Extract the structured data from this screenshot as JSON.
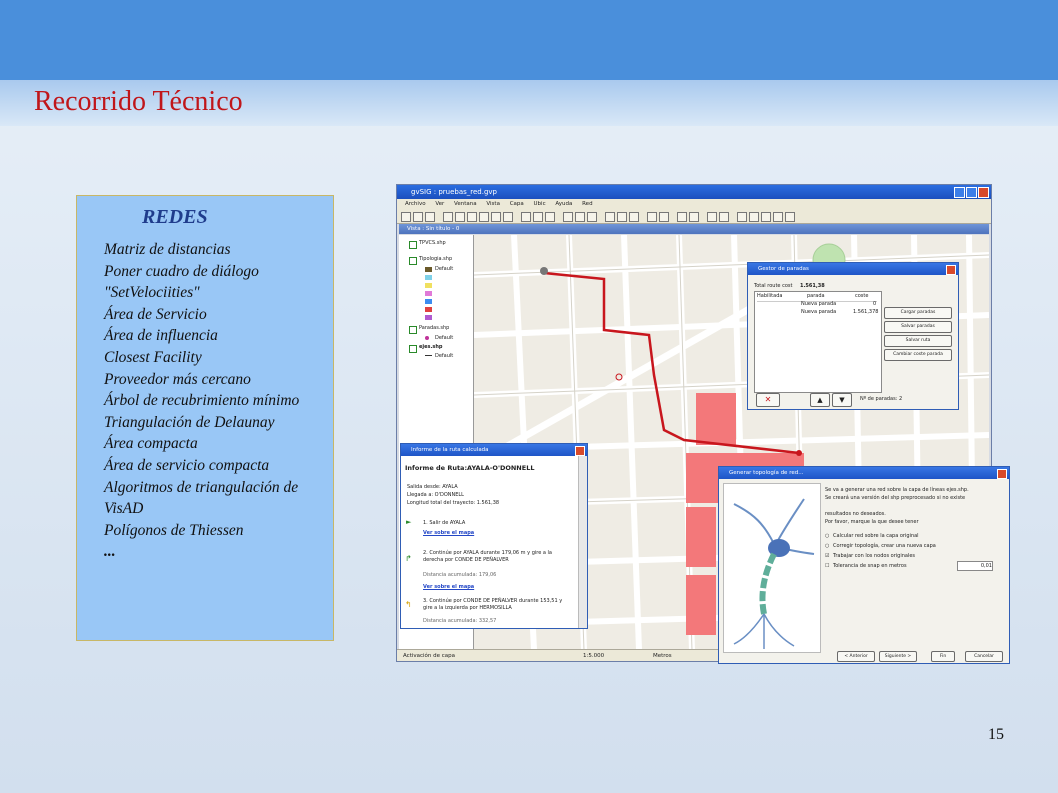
{
  "slide": {
    "title": "Recorrido Técnico",
    "page_number": "15"
  },
  "list": {
    "heading": "REDES",
    "items": [
      "Matriz de distancias",
      "Poner cuadro de diálogo",
      "\"SetVelociities\"",
      "Área de Servicio",
      "Área de influencia",
      "Closest Facility",
      "Proveedor más cercano",
      "Árbol de recubrimiento mínimo",
      "Triangulación de Delaunay",
      "Área compacta",
      "Área de servicio compacta",
      "Algoritmos de triangulación de",
      "VisAD",
      "Polígonos de Thiessen",
      "..."
    ]
  },
  "screenshot": {
    "app_title": "gvSIG : pruebas_red.gvp",
    "menu": [
      "Archivo",
      "Ver",
      "Ventana",
      "Vista",
      "Capa",
      "Ubic",
      "Ayuda",
      "Red"
    ],
    "view_title": "Vista : Sin título - 0",
    "toc": {
      "layers": [
        "TPVCS.shp",
        "Tipologia.shp",
        "Paradas.shp",
        "ejes.shp"
      ],
      "legend_default": "Default"
    },
    "status": {
      "left": "Activación de capa",
      "scale": "1:5.000",
      "units": "Metros"
    },
    "stops_dialog": {
      "title": "Gestor de paradas",
      "total_label": "Total route cost",
      "total_value": "1.561,38",
      "columns": [
        "Habilitada",
        "parada",
        "coste"
      ],
      "rows": [
        [
          "",
          "Nueva parada",
          "0"
        ],
        [
          "",
          "Nueva parada",
          "1.561,378"
        ]
      ],
      "buttons": [
        "Cargar paradas",
        "Salvar paradas",
        "Salvar ruta",
        "Cambiar coste parada"
      ],
      "count_label": "Nº de paradas: 2"
    },
    "route_dialog": {
      "title": "Informe de la ruta calculada",
      "heading": "Informe de Ruta:AYALA-O'DONNELL",
      "lines": [
        "Salida desde: AYALA",
        "Llegada a: O'DONNELL",
        "Longitud total del trayecto: 1.561,38",
        "1. Salir de AYALA",
        "Ver sobre el mapa",
        "2. Continúe por AYALA durante 179,06 m y gire a la derecha por CONDE DE PEÑALVER",
        "Distancia acumulada: 179,06",
        "Ver sobre el mapa",
        "3. Continúe por CONDE DE PEÑALVER durante 153,51 y gire a la izquierda por HERMOSILLA",
        "Distancia acumulada: 332,57"
      ]
    },
    "topology_dialog": {
      "title": "Generar topología de red...",
      "text": [
        "Se va a generar una red sobre la capa de líneas ejes.shp.",
        "Se creará una versión del shp preprocesado si no existe",
        "resultados no deseados.",
        "Por favor, marque la que desee tener"
      ],
      "options": [
        "Calcular red sobre la capa original",
        "Corregir topología, crear una nueva capa",
        "Trabajar con los nodos originales",
        "Tolerancia de snap en metros"
      ],
      "tolerance": "0,01",
      "buttons": [
        "< Anterior",
        "Siguiente >",
        "Fin",
        "Cancelar"
      ]
    }
  }
}
